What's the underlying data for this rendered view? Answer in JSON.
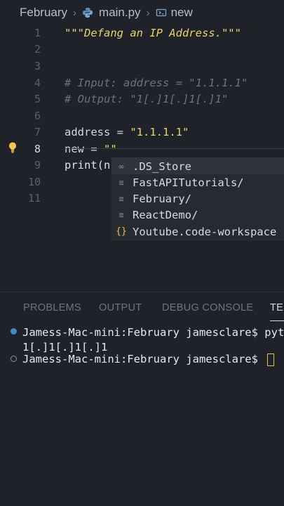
{
  "breadcrumb": {
    "folder": "February",
    "file": "main.py",
    "symbol": "new"
  },
  "editor": {
    "lines": [
      {
        "num": "1",
        "text": "\"\"\"Defang an IP Address.\"\"\""
      },
      {
        "num": "2",
        "text": ""
      },
      {
        "num": "3",
        "text": ""
      },
      {
        "num": "4",
        "text": "# Input: address = \"1.1.1.1\""
      },
      {
        "num": "5",
        "text": "# Output: \"1[.]1[.]1[.]1\""
      },
      {
        "num": "6",
        "text": ""
      },
      {
        "num": "7",
        "text_a": "address = ",
        "text_b": "\"1.1.1.1\""
      },
      {
        "num": "8",
        "text_a": "new = ",
        "text_b": "\"\""
      },
      {
        "num": "9",
        "text": "print(n"
      },
      {
        "num": "10",
        "text": ""
      },
      {
        "num": "11",
        "text": ""
      }
    ]
  },
  "suggestions": [
    {
      "label": ".DS_Store",
      "icon": "file-icon"
    },
    {
      "label": "FastAPITutorials/",
      "icon": "folder-icon"
    },
    {
      "label": "February/",
      "icon": "folder-icon"
    },
    {
      "label": "ReactDemo/",
      "icon": "folder-icon"
    },
    {
      "label": "Youtube.code-workspace",
      "icon": "braces-icon"
    }
  ],
  "panel": {
    "tabs": [
      "PROBLEMS",
      "OUTPUT",
      "DEBUG CONSOLE",
      "TER"
    ]
  },
  "terminal": {
    "line1": "Jamess-Mac-mini:February jamesclare$ pytho",
    "line2": "1[.]1[.]1[.]1",
    "line3": "Jamess-Mac-mini:February jamesclare$ "
  },
  "colors": {
    "background": "#1f2228",
    "string": "#e9d36b",
    "comment": "#6b7280",
    "accent": "#3c8ec4"
  }
}
